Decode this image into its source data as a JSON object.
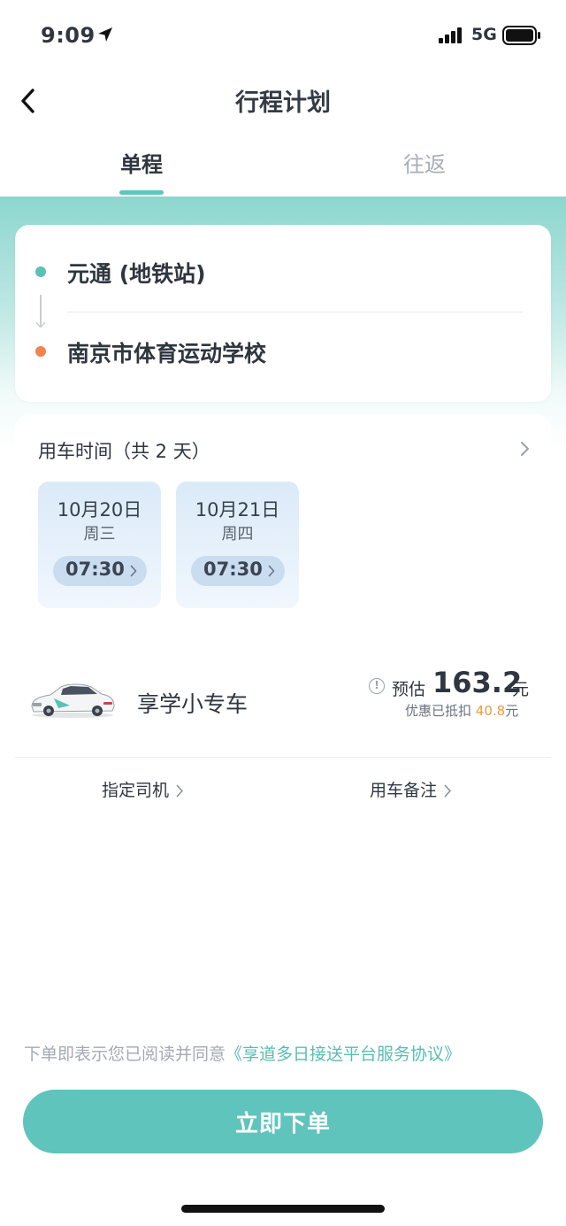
{
  "status_bar": {
    "time": "9:09",
    "network": "5G"
  },
  "nav": {
    "title": "行程计划"
  },
  "tabs": [
    {
      "label": "单程",
      "active": true
    },
    {
      "label": "往返",
      "active": false
    }
  ],
  "route": {
    "from": "元通 (地铁站)",
    "to": "南京市体育运动学校"
  },
  "schedule": {
    "title": "用车时间（共 2 天）",
    "days": [
      {
        "date": "10月20日",
        "weekday": "周三",
        "time": "07:30"
      },
      {
        "date": "10月21日",
        "weekday": "周四",
        "time": "07:30"
      }
    ]
  },
  "car": {
    "name": "享学小专车",
    "estimate_label": "预估",
    "price": "163.2",
    "price_unit": "元",
    "discount_prefix": "优惠已抵扣",
    "discount_amount": "40.8",
    "discount_unit": "元",
    "options": [
      "指定司机",
      "用车备注"
    ]
  },
  "agreement": {
    "text": "下单即表示您已阅读并同意",
    "link": "《享道多日接送平台服务协议》"
  },
  "submit_label": "立即下单",
  "colors": {
    "accent": "#5fc4bb",
    "from_dot": "#5bc0b7",
    "to_dot": "#f0834e",
    "discount": "#ef9a3a"
  },
  "icons": [
    "location-arrow-icon",
    "signal-icon",
    "battery-icon",
    "back-icon",
    "chevron-right-icon",
    "info-icon",
    "car-image"
  ]
}
